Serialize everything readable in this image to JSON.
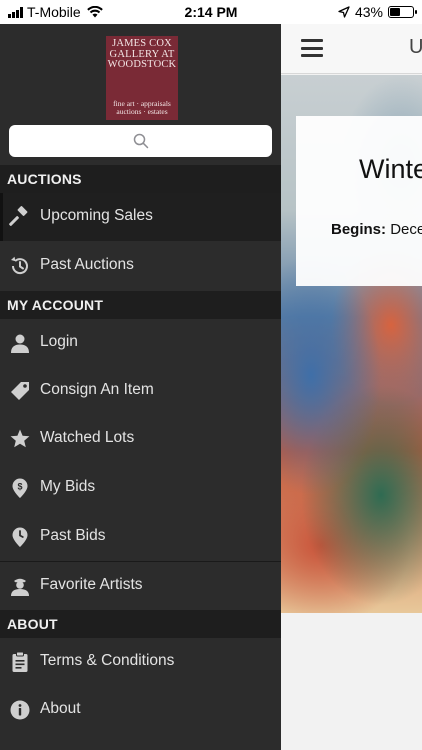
{
  "status_bar": {
    "carrier": "T-Mobile",
    "time": "2:14 PM",
    "battery": "43%"
  },
  "main": {
    "title": "U",
    "card_title": "Winte",
    "begins_label": "Begins:",
    "begins_value": "Dece"
  },
  "drawer": {
    "logo": {
      "line1": "JAMES COX",
      "line2": "GALLERY AT",
      "line3": "WOODSTOCK",
      "line4": "fine art · appraisals",
      "line5": "auctions · estates"
    },
    "search": {
      "placeholder": ""
    },
    "sections": {
      "auctions": "AUCTIONS",
      "my_account": "MY ACCOUNT",
      "about": "ABOUT"
    },
    "items": {
      "upcoming_sales": "Upcoming Sales",
      "past_auctions": "Past Auctions",
      "login": "Login",
      "consign": "Consign An Item",
      "watched_lots": "Watched Lots",
      "my_bids": "My Bids",
      "past_bids": "Past Bids",
      "favorite_artists": "Favorite Artists",
      "terms": "Terms & Conditions",
      "about": "About"
    }
  },
  "colors": {
    "drawer_bg": "#2c2c2c",
    "section_bg": "#1e1e1e",
    "logo_bg": "#7a2a36"
  }
}
